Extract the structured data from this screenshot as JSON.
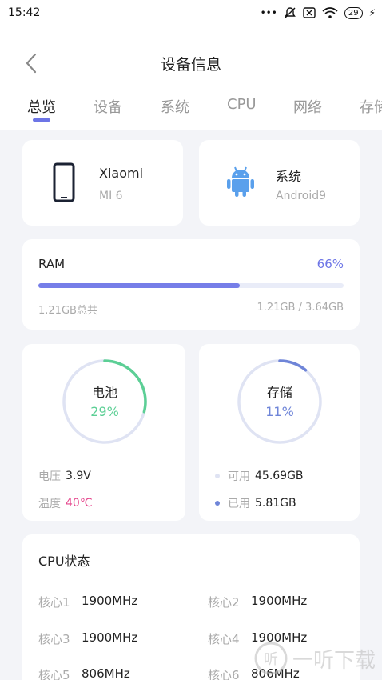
{
  "status_bar": {
    "time": "15:42",
    "battery": "29",
    "icons": [
      "more-dots-icon",
      "mute-icon",
      "sim-icon",
      "wifi-icon",
      "battery-icon",
      "charging-icon"
    ]
  },
  "header": {
    "title": "设备信息"
  },
  "tabs": [
    {
      "label": "总览",
      "active": true
    },
    {
      "label": "设备",
      "active": false
    },
    {
      "label": "系统",
      "active": false
    },
    {
      "label": "CPU",
      "active": false
    },
    {
      "label": "网络",
      "active": false
    },
    {
      "label": "存储",
      "active": false
    }
  ],
  "device_card": {
    "brand": "Xiaomi",
    "model": "MI 6",
    "icon": "phone-icon"
  },
  "system_card": {
    "title": "系统",
    "version": "Android9",
    "icon": "android-icon"
  },
  "ram": {
    "label": "RAM",
    "percent_text": "66%",
    "fraction": 0.66,
    "total_text": "1.21GB总共",
    "usage_text": "1.21GB / 3.64GB"
  },
  "battery": {
    "label": "电池",
    "percent_text": "29%",
    "fraction": 0.29,
    "voltage_key": "电压",
    "voltage": "3.9V",
    "temp_key": "温度",
    "temp": "40℃"
  },
  "storage": {
    "label": "存储",
    "percent_text": "11%",
    "fraction": 0.11,
    "free_key": "可用",
    "free": "45.69GB",
    "used_key": "已用",
    "used": "5.81GB"
  },
  "cpu": {
    "title": "CPU状态",
    "cores": [
      {
        "label": "核心1",
        "freq": "1900MHz"
      },
      {
        "label": "核心2",
        "freq": "1900MHz"
      },
      {
        "label": "核心3",
        "freq": "1900MHz"
      },
      {
        "label": "核心4",
        "freq": "1900MHz"
      },
      {
        "label": "核心5",
        "freq": "806MHz"
      },
      {
        "label": "核心6",
        "freq": "806MHz"
      }
    ]
  },
  "watermark": {
    "text": "一听下载"
  },
  "colors": {
    "accent": "#6d75e6",
    "battery_green": "#5ccf95",
    "storage_blue": "#6f85d8",
    "temp_pink": "#e5458c",
    "ring_track": "#dfe3f3"
  }
}
